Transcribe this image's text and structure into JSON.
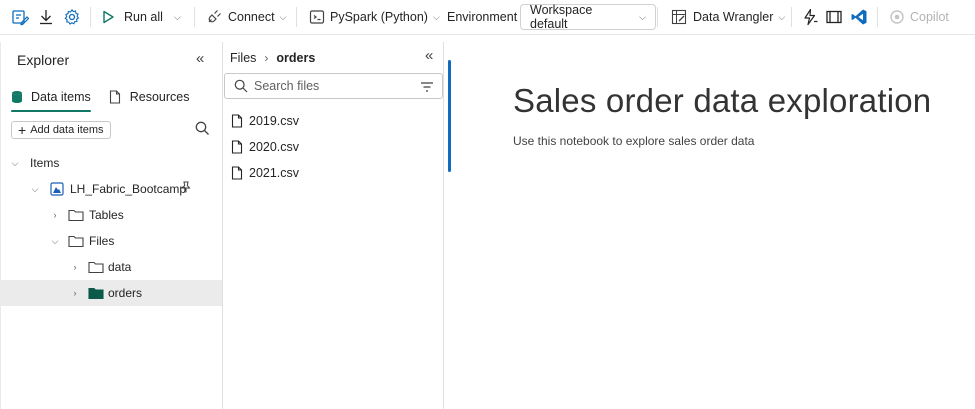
{
  "toolbar": {
    "run_all": "Run all",
    "connect": "Connect",
    "language": "PySpark (Python)",
    "environment_label": "Environment",
    "workspace": "Workspace default",
    "data_wrangler": "Data Wrangler",
    "copilot": "Copilot"
  },
  "explorer": {
    "title": "Explorer",
    "tabs": [
      {
        "label": "Data items",
        "active": true
      },
      {
        "label": "Resources",
        "active": false
      }
    ],
    "add_button": "Add data items",
    "tree": [
      {
        "label": "Items",
        "level": 0,
        "expanded": true,
        "icon": "none"
      },
      {
        "label": "LH_Fabric_Bootcamp",
        "level": 1,
        "expanded": true,
        "icon": "lakehouse-icon",
        "pinned": true
      },
      {
        "label": "Tables",
        "level": 2,
        "expanded": false,
        "icon": "folder-icon"
      },
      {
        "label": "Files",
        "level": 2,
        "expanded": true,
        "icon": "folder-icon"
      },
      {
        "label": "data",
        "level": 3,
        "expanded": false,
        "icon": "folder-icon"
      },
      {
        "label": "orders",
        "level": 3,
        "expanded": false,
        "icon": "folder-filled-icon",
        "selected": true
      }
    ]
  },
  "files_panel": {
    "breadcrumb": [
      "Files",
      "orders"
    ],
    "search_placeholder": "Search files",
    "files": [
      "2019.csv",
      "2020.csv",
      "2021.csv"
    ]
  },
  "notebook": {
    "title": "Sales order data exploration",
    "description": "Use this notebook to explore sales order data"
  },
  "colors": {
    "accent_green": "#117865",
    "cell_bar_blue": "#0f6cbd",
    "selected_row": "#ebebeb"
  }
}
